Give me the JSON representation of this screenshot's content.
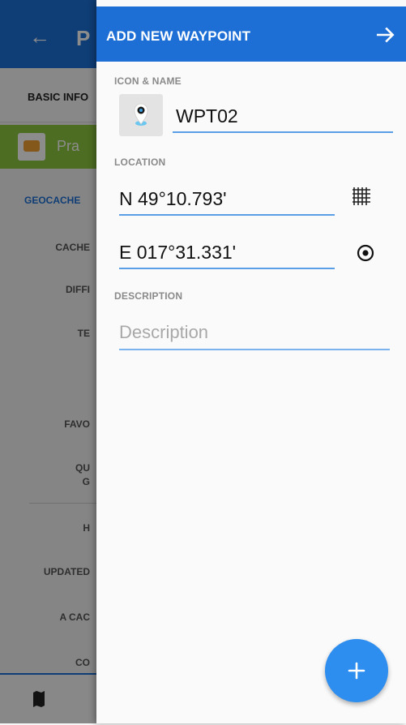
{
  "background": {
    "back_glyph": "←",
    "title_partial": "P",
    "tab_label": "BASIC INFO",
    "banner_text": "Pra",
    "section_label": "GEOCACHE",
    "rows": [
      "CACHE",
      "DIFFI",
      "TE",
      "FAVO",
      "QU",
      "G",
      "H",
      "UPDATED",
      "A CAC",
      "CO"
    ]
  },
  "drawer": {
    "title": "ADD NEW WAYPOINT",
    "icon_name_label": "ICON & NAME",
    "name_value": "WPT02",
    "location_label": "LOCATION",
    "latitude_value": "N 49°10.793'",
    "longitude_value": "E 017°31.331'",
    "description_label": "DESCRIPTION",
    "description_value": "",
    "description_placeholder": "Description",
    "fab_label": "+"
  },
  "colors": {
    "primary": "#1d6fd6",
    "accent_fab": "#2d8ef0",
    "banner_green": "#8cc63f",
    "underline": "#5a9fe6"
  },
  "icons": {
    "next": "arrow-right-icon",
    "coordinate_grid": "grid-icon",
    "current_location": "target-icon",
    "waypoint": "map-pin-icon",
    "fab": "plus-icon"
  }
}
